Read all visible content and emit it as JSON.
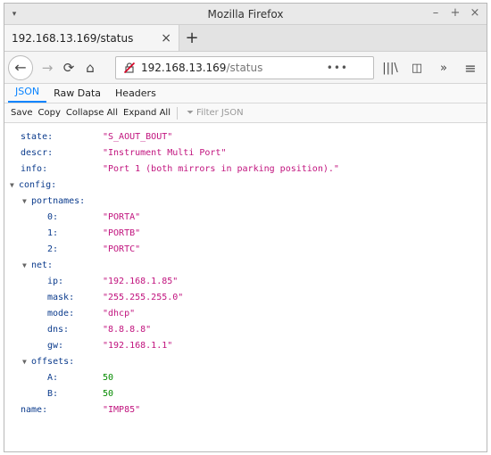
{
  "window": {
    "title": "Mozilla Firefox",
    "menu_glyph": "▾",
    "controls": {
      "minimize": "–",
      "maximize": "+",
      "close": "×"
    }
  },
  "tab": {
    "label": "192.168.13.169/status",
    "close": "×",
    "new_tab": "+"
  },
  "nav": {
    "back": "←",
    "forward": "→",
    "reload": "⟳",
    "home": "⌂",
    "url_host": "192.168.13.169",
    "url_path": "/status",
    "page_actions": "•••",
    "bookmark": "☆",
    "library": "|||\\",
    "sidebar": "◫",
    "overflow": "»",
    "menu": "≡"
  },
  "viewer": {
    "tabs": [
      "JSON",
      "Raw Data",
      "Headers"
    ],
    "active_tab": "JSON",
    "buttons": [
      "Save",
      "Copy",
      "Collapse All",
      "Expand All"
    ],
    "filter_placeholder": "Filter JSON"
  },
  "json": {
    "state_key": "state:",
    "state_val": "\"S_AOUT_BOUT\"",
    "descr_key": "descr:",
    "descr_val": "\"Instrument Multi Port\"",
    "info_key": "info:",
    "info_val": "\"Port 1 (both mirrors in parking position).\"",
    "config_key": "config:",
    "portnames_key": "portnames:",
    "p0_key": "0:",
    "p0_val": "\"PORTA\"",
    "p1_key": "1:",
    "p1_val": "\"PORTB\"",
    "p2_key": "2:",
    "p2_val": "\"PORTC\"",
    "net_key": "net:",
    "ip_key": "ip:",
    "ip_val": "\"192.168.1.85\"",
    "mask_key": "mask:",
    "mask_val": "\"255.255.255.0\"",
    "mode_key": "mode:",
    "mode_val": "\"dhcp\"",
    "dns_key": "dns:",
    "dns_val": "\"8.8.8.8\"",
    "gw_key": "gw:",
    "gw_val": "\"192.168.1.1\"",
    "offsets_key": "offsets:",
    "a_key": "A:",
    "a_val": "50",
    "b_key": "B:",
    "b_val": "50",
    "name_key": "name:",
    "name_val": "\"IMP85\""
  },
  "colors": {
    "key": "#0b3b8c",
    "string": "#c1137e",
    "number": "#058b00",
    "accent": "#0a84ff"
  }
}
